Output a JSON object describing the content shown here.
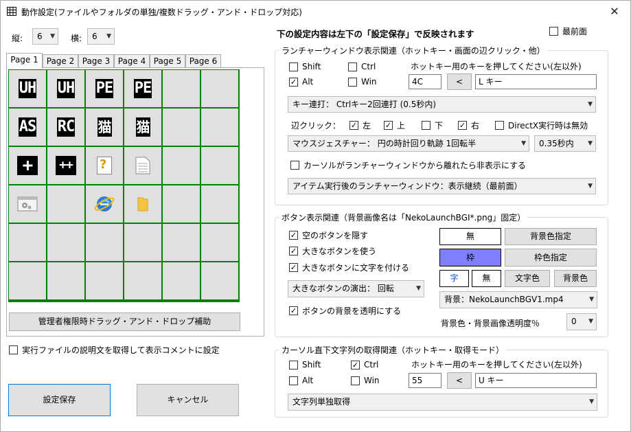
{
  "window": {
    "title": "動作設定(ファイルやフォルダの単独/複数ドラッグ・アンド・ドロップ対応)",
    "close": "✕"
  },
  "grid_size": {
    "rows_label": "縦:",
    "rows_value": "6",
    "cols_label": "横:",
    "cols_value": "6"
  },
  "tabs": [
    "Page 1",
    "Page 2",
    "Page 3",
    "Page 4",
    "Page 5",
    "Page 6"
  ],
  "grid_cells": [
    {
      "text": "UH",
      "icon": "uh-text-icon"
    },
    {
      "text": "UH",
      "icon": "uh-text-icon"
    },
    {
      "text": "PE",
      "icon": "pe-text-icon"
    },
    {
      "text": "PE",
      "icon": "pe-text-icon"
    },
    {
      "text": "AS",
      "icon": "as-text-icon"
    },
    {
      "text": "RC",
      "icon": "rc-text-icon"
    },
    {
      "text": "猫",
      "icon": "cat-kanji-icon"
    },
    {
      "text": "猫",
      "icon": "cat-kanji-icon"
    },
    {
      "text": "+",
      "icon": "plus-icon"
    },
    {
      "text": "++",
      "icon": "plus-plus-icon"
    },
    {
      "text": "?",
      "icon": "help-document-icon"
    },
    {
      "text": "",
      "icon": "document-icon"
    },
    {
      "text": "",
      "icon": "settings-window-icon"
    },
    {
      "text": "",
      "icon": "internet-explorer-icon"
    },
    {
      "text": "",
      "icon": "folder-icon"
    }
  ],
  "admin_drag_button": "管理者権限時ドラッグ・アンド・ドロップ補助",
  "exec_desc_checkbox": "実行ファイルの説明文を取得して表示コメントに設定",
  "save_button": "設定保存",
  "cancel_button": "キャンセル",
  "header_note": "下の設定内容は左下の「設定保存」で反映されます",
  "topmost_checkbox": "最前面",
  "launcher": {
    "group_title": "ランチャーウィンドウ表示関連（ホットキー・画面の辺クリック・他）",
    "shift": "Shift",
    "ctrl": "Ctrl",
    "alt": "Alt",
    "win": "Win",
    "hotkey_prompt": "ホットキー用のキーを押してください(左以外)",
    "keycode": "4C",
    "arrow_btn": "<",
    "key_name": "L キー",
    "repeat_select": "キー連打： Ctrlキー2回連打 (0.5秒内)",
    "edge_label": "辺クリック：",
    "left": "左",
    "top": "上",
    "bottom": "下",
    "right": "右",
    "directx": "DirectX実行時は無効",
    "gesture_select": "マウスジェスチャー： 円の時計回り軌跡 1回転半",
    "gesture_time": "0.35秒内",
    "hide_checkbox": "カーソルがランチャーウィンドウから離れたら非表示にする",
    "after_exec_select": "アイテム実行後のランチャーウィンドウ：表示継続（最前面）"
  },
  "button_display": {
    "group_title": "ボタン表示関連（背景画像名は「NekoLaunchBGI*.png」固定）",
    "hide_empty": "空のボタンを隠す",
    "use_large": "大きなボタンを使う",
    "large_text": "大きなボタンに文字を付ける",
    "effect_select": "大きなボタンの演出： 回転",
    "transparent": "ボタンの背景を透明にする",
    "none_btn": "無",
    "bg_color_btn": "背景色指定",
    "frame_btn": "枠",
    "frame_color_btn": "枠色指定",
    "char_btn": "字",
    "none_btn2": "無",
    "text_color_btn": "文字色",
    "bg_color_btn2": "背景色",
    "bg_image_select": "背景：NekoLaunchBGV1.mp4",
    "opacity_label": "背景色・背景画像透明度％",
    "opacity_value": "0",
    "frame_color": "#8080ff"
  },
  "cursor_text": {
    "group_title": "カーソル直下文字列の取得関連（ホットキー・取得モード）",
    "shift": "Shift",
    "ctrl": "Ctrl",
    "alt": "Alt",
    "win": "Win",
    "hotkey_prompt": "ホットキー用のキーを押してください(左以外)",
    "keycode": "55",
    "arrow_btn": "<",
    "key_name": "U キー",
    "mode_select": "文字列単独取得"
  }
}
